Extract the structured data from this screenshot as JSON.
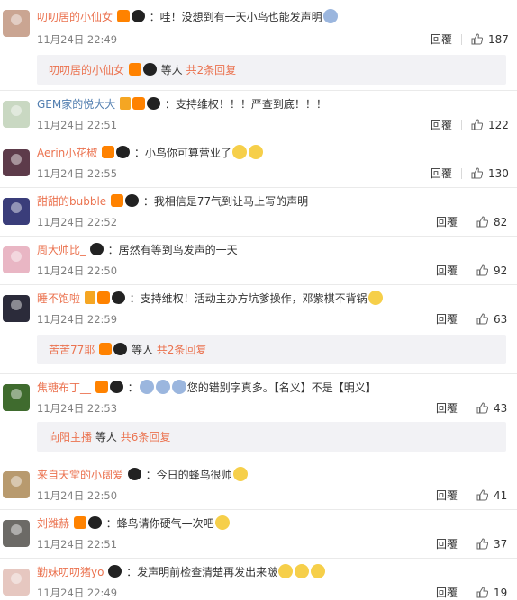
{
  "colors": {
    "name": "#eb7350",
    "link": "#507daf",
    "time": "#808080",
    "thread_bg": "#f2f2f5"
  },
  "reply_label": "回覆",
  "comments": [
    {
      "name": "叨叨居的小仙女",
      "text": "：哇！没想到有一天小鸟也能发声明",
      "time": "11月24日 22:49",
      "likes": "187",
      "avatar_color": "#caa592",
      "thread": {
        "who": "叨叨居的小仙女",
        "etc": "等人",
        "more": "共2条回复"
      }
    },
    {
      "name": "GEM家的悦大大",
      "text": "：支持维权！！！严查到底！！！",
      "time": "11月24日 22:51",
      "likes": "122",
      "avatar_color": "#c9d8c2"
    },
    {
      "name": "Aerin小花椒",
      "text": "：小鸟你可算营业了",
      "time": "11月24日 22:55",
      "likes": "130",
      "avatar_color": "#5d3b4a"
    },
    {
      "name": "甜甜的bubble",
      "text": "：我相信是77气到让马上写的声明",
      "time": "11月24日 22:52",
      "likes": "82",
      "avatar_color": "#3a3d7a"
    },
    {
      "name": "周大帅比_",
      "text": "：居然有等到鸟发声的一天",
      "time": "11月24日 22:50",
      "likes": "92",
      "avatar_color": "#e9b6c4"
    },
    {
      "name": "睡不饱啦",
      "text": "：支持维权！活动主办方坑爹操作，邓紫棋不背锅",
      "time": "11月24日 22:59",
      "likes": "63",
      "avatar_color": "#2b2b3a",
      "thread": {
        "who": "苦苦77耶",
        "etc": "等人",
        "more": "共2条回复"
      }
    },
    {
      "name": "焦糖布丁__",
      "text": "：",
      "text2": "您的错别字真多。【名义】不是【明义】",
      "time": "11月24日 22:53",
      "likes": "43",
      "avatar_color": "#3f6b2e",
      "thread": {
        "who": "向阳主播",
        "etc": "等人",
        "more": "共6条回复"
      }
    },
    {
      "name": "来自天堂的小阔爱",
      "text": "：今日的蜂鸟很帅",
      "time": "11月24日 22:50",
      "likes": "41",
      "avatar_color": "#b89a6e"
    },
    {
      "name": "刘潍赫",
      "text": "：蜂鸟请你硬气一次吧",
      "time": "11月24日 22:51",
      "likes": "37",
      "avatar_color": "#6c6a66"
    },
    {
      "name": "勤妹叨叨猪yo",
      "text": "：发声明前检查清楚再发出来啵",
      "time": "11月24日 22:49",
      "likes": "19",
      "avatar_color": "#e6c7c0"
    }
  ]
}
